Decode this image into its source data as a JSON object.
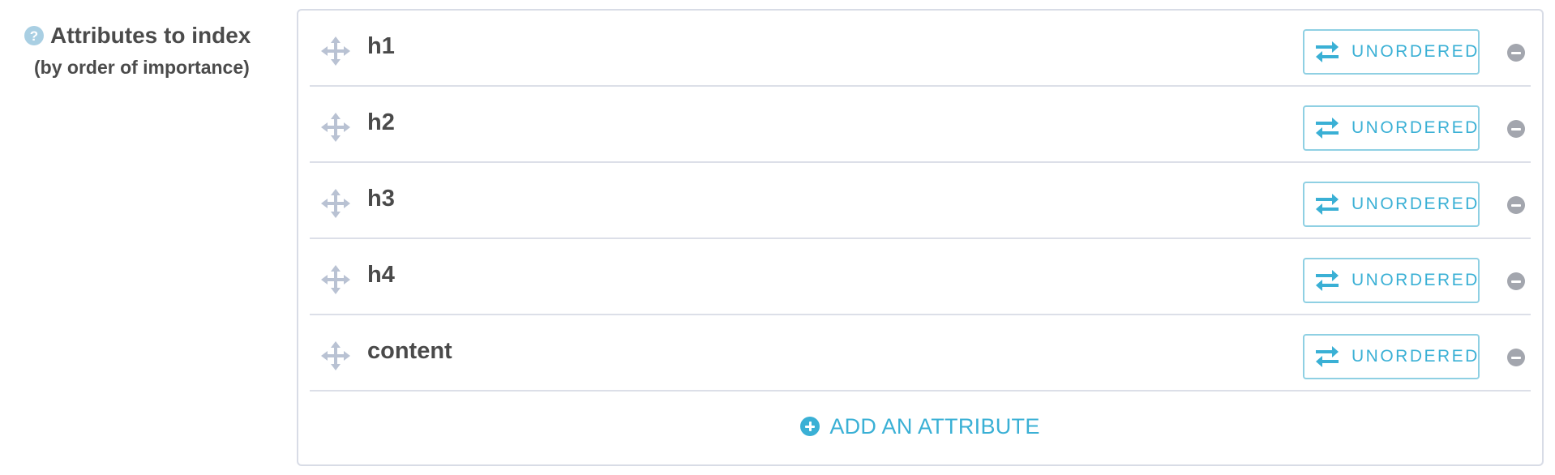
{
  "field": {
    "label": "Attributes to index",
    "sublabel": "(by order of importance)",
    "help_icon": "question-circle-icon"
  },
  "attributes": [
    {
      "name": "h1",
      "order_label": "UNORDERED"
    },
    {
      "name": "h2",
      "order_label": "UNORDERED"
    },
    {
      "name": "h3",
      "order_label": "UNORDERED"
    },
    {
      "name": "h4",
      "order_label": "UNORDERED"
    },
    {
      "name": "content",
      "order_label": "UNORDERED"
    }
  ],
  "add_button": {
    "label": "ADD AN ATTRIBUTE",
    "icon": "plus-circle-icon"
  },
  "icons": {
    "drag": "move-arrows-icon",
    "order": "swap-arrows-icon",
    "remove": "minus-circle-icon"
  },
  "colors": {
    "accent": "#3ab0d5",
    "button_border": "#8fd0e3",
    "drag_icon": "#b9c2d3",
    "remove_icon": "#a3a6ae",
    "help_icon": "#a9cfe3",
    "divider": "#dcdfe8"
  }
}
